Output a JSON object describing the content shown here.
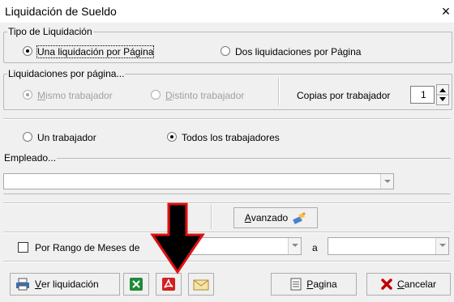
{
  "window": {
    "title": "Liquidación de Sueldo",
    "close_glyph": "×"
  },
  "tipo_liquidacion": {
    "legend": "Tipo de Liquidación",
    "options": [
      {
        "label": "Una liquidación por Página",
        "selected": true
      },
      {
        "label": "Dos liquidaciones por Página",
        "selected": false
      }
    ]
  },
  "liquidaciones_por_pagina": {
    "legend": "Liquidaciones por página...",
    "options": [
      {
        "accel": "M",
        "rest": "ismo trabajador",
        "selected": true,
        "enabled": false
      },
      {
        "accel": "D",
        "rest": "istinto trabajador",
        "selected": false,
        "enabled": false
      }
    ],
    "copias_label": "Copias por trabajador",
    "copias_value": "1"
  },
  "trabajadores": {
    "options": [
      {
        "label": "Un trabajador",
        "selected": false
      },
      {
        "label": "Todos los trabajadores",
        "selected": true
      }
    ]
  },
  "empleado": {
    "legend": "Empleado...",
    "value": ""
  },
  "avanzado": {
    "accel": "A",
    "rest": "vanzado",
    "icon": "wand-icon"
  },
  "rango": {
    "label": "Por Rango de Meses de",
    "checked": false,
    "from_value": "",
    "separator": "a",
    "to_value": ""
  },
  "toolbar": {
    "ver_accel": "V",
    "ver_rest": "er liquidación",
    "pagina_accel": "P",
    "pagina_rest": "agina",
    "cancelar_accel": "C",
    "cancelar_rest": "ancelar"
  },
  "icons": {
    "printer": "printer-icon",
    "excel": "excel-icon",
    "pdf": "pdf-icon",
    "email": "email-icon",
    "pagina": "page-icon",
    "cancel": "cancel-x-icon",
    "arrow": "down-arrow-annotation"
  },
  "colors": {
    "excel_green": "#1f8a3a",
    "pdf_red": "#d32020",
    "cancel_red": "#c00000",
    "annotation_black": "#000000",
    "annotation_red": "#e01010"
  }
}
